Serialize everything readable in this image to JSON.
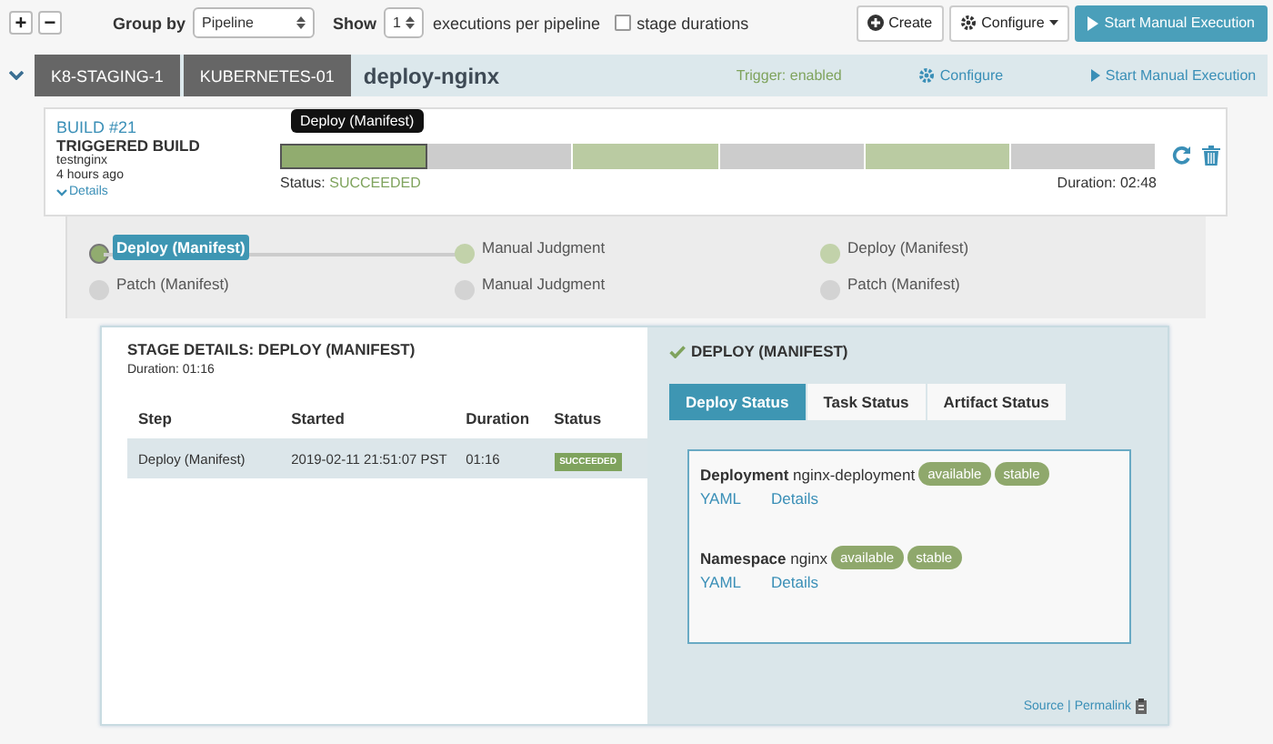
{
  "toolbar": {
    "expand_label": "+",
    "collapse_label": "−",
    "group_by_label": "Group by",
    "group_by_value": "Pipeline",
    "show_label": "Show",
    "show_value": "1",
    "show_suffix": "executions per pipeline",
    "stage_durations": {
      "label": "stage durations",
      "checked": false
    },
    "buttons": [
      {
        "kind": "create",
        "label": "Create"
      },
      {
        "kind": "configure",
        "label": "Configure"
      },
      {
        "kind": "start",
        "label": "Start Manual Execution"
      }
    ]
  },
  "pipeline": {
    "expanded": true,
    "tags": [
      "K8-STAGING-1",
      "KUBERNETES-01"
    ],
    "name": "deploy-nginx",
    "trigger": "Trigger: enabled",
    "configure": "Configure",
    "start": "Start Manual Execution"
  },
  "build": {
    "number": "BUILD #21",
    "trigger": "TRIGGERED BUILD",
    "user": "testnginx",
    "time": "4 hours ago",
    "details": "Details",
    "tooltip": "Deploy (Manifest)",
    "status_label": "Status:",
    "status": "SUCCEEDED",
    "duration": "Duration: 02:48",
    "segments": [
      {
        "succeeded": true,
        "selected": true
      },
      {
        "succeeded": false,
        "selected": false
      },
      {
        "succeeded": true,
        "selected": false
      },
      {
        "succeeded": false,
        "selected": false
      },
      {
        "succeeded": true,
        "selected": false
      },
      {
        "succeeded": false,
        "selected": false
      }
    ]
  },
  "stage_graph": {
    "rows": [
      [
        {
          "label": "Deploy (Manifest)",
          "succeeded": true,
          "selected": true
        },
        {
          "label": "Manual Judgment",
          "succeeded": true,
          "selected": false
        },
        {
          "label": "Deploy (Manifest)",
          "succeeded": true,
          "selected": false
        }
      ],
      [
        {
          "label": "Patch (Manifest)",
          "succeeded": false,
          "selected": false
        },
        {
          "label": "Manual Judgment",
          "succeeded": false,
          "selected": false
        },
        {
          "label": "Patch (Manifest)",
          "succeeded": false,
          "selected": false
        }
      ]
    ]
  },
  "stage_details": {
    "title": "STAGE DETAILS: DEPLOY (MANIFEST)",
    "duration": "Duration: 01:16",
    "columns": [
      "Step",
      "Started",
      "Duration",
      "Status"
    ],
    "rows": [
      {
        "step": "Deploy (Manifest)",
        "started": "2019-02-11 21:51:07 PST",
        "duration": "01:16",
        "status": "SUCCEEDED",
        "selected": true
      }
    ]
  },
  "step_panel": {
    "title": "DEPLOY (MANIFEST)",
    "tabs": [
      {
        "label": "Deploy Status",
        "selected": true
      },
      {
        "label": "Task Status",
        "selected": false
      },
      {
        "label": "Artifact Status",
        "selected": false
      }
    ],
    "resources": [
      {
        "kind": "Deployment",
        "name": "nginx-deployment",
        "badges": [
          "available",
          "stable"
        ],
        "links": [
          "YAML",
          "Details"
        ]
      },
      {
        "kind": "Namespace",
        "name": "nginx",
        "badges": [
          "available",
          "stable"
        ],
        "links": [
          "YAML",
          "Details"
        ]
      }
    ],
    "footer_links": [
      "Source",
      "Permalink"
    ],
    "footer_separator": "|"
  }
}
